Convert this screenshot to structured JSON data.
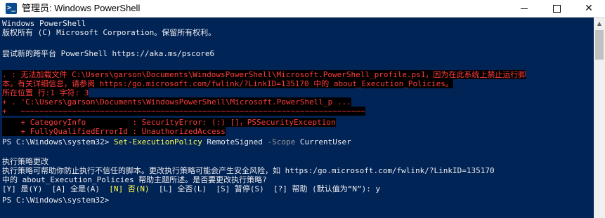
{
  "window": {
    "icon_glyph": ">_",
    "title": "管理员: Windows PowerShell",
    "minimize_glyph": "—",
    "maximize_glyph": "□",
    "close_glyph": "✕"
  },
  "console": {
    "banner1": "Windows PowerShell",
    "banner2": "版权所有 (C) Microsoft Corporation。保留所有权利。",
    "banner3": "尝试新的跨平台 PowerShell https://aka.ms/pscore6",
    "error_lines": [
      ". : 无法加载文件 C:\\Users\\garson\\Documents\\WindowsPowerShell\\Microsoft.PowerShell_profile.ps1，因为在此系统上禁止运行脚",
      "本。有关详细信息，请参阅 https:/go.microsoft.com/fwlink/?LinkID=135170 中的 about_Execution_Policies。",
      "所在位置 行:1 字符: 3",
      "+ . 'C:\\Users\\garson\\Documents\\WindowsPowerShell\\Microsoft.PowerShell_p ...",
      "+   ~~~~~~~~~~~~~~~~~~~~~~~~~~~~~~~~~~~~~~~~~~~~~~~~~~~~~~~~~~~~~~~~~~~~~~~~~~",
      "    + CategoryInfo          : SecurityError: (:) []，PSSecurityException",
      "    + FullyQualifiedErrorId : UnauthorizedAccess"
    ],
    "prompt1": "PS C:\\Windows\\system32> ",
    "command_cmdlet": "Set-ExecutionPolicy",
    "command_arg1": " RemoteSigned ",
    "command_param": "-Scope",
    "command_arg2": " CurrentUser",
    "policy_lines": [
      "执行策略更改",
      "执行策略可帮助你防止执行不信任的脚本。更改执行策略可能会产生安全风险，如 https:/go.microsoft.com/fwlink/?LinkID=135170",
      "中的 about_Execution_Policies 帮助主题所述。是否要更改执行策略?"
    ],
    "choice_prefix": "[Y] 是(Y)  [A] 全是(A)  ",
    "choice_default": "[N] 否(N)",
    "choice_suffix": "  [L] 全否(L)  [S] 暂停(S)  [?] 帮助 (默认值为“N”): y",
    "prompt2": "PS C:\\Windows\\system32> "
  },
  "colors": {
    "console_bg": "#012456",
    "error_fg": "#ff3b3b",
    "cmdlet_fg": "#fefc53",
    "param_fg": "#9a9a9a"
  }
}
